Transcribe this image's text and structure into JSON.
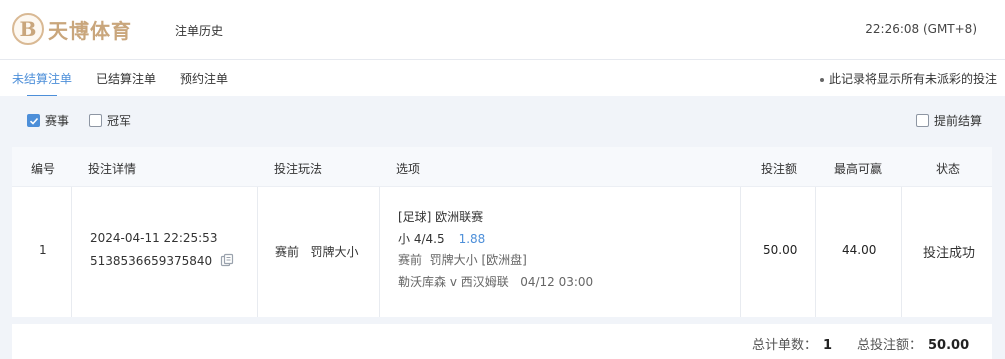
{
  "header": {
    "logo_letter": "B",
    "logo_text": "天博体育",
    "page_title": "注单历史",
    "clock": "22:26:08 (GMT+8)"
  },
  "tabs": [
    {
      "label": "未结算注单",
      "active": true
    },
    {
      "label": "已结算注单",
      "active": false
    },
    {
      "label": "预约注单",
      "active": false
    }
  ],
  "tab_note": "此记录将显示所有未派彩的投注",
  "filters": {
    "event": {
      "label": "赛事",
      "checked": true
    },
    "champion": {
      "label": "冠军",
      "checked": false
    },
    "cashout": {
      "label": "提前结算",
      "checked": false
    }
  },
  "table": {
    "headers": {
      "no": "编号",
      "detail": "投注详情",
      "play": "投注玩法",
      "option": "选项",
      "stake": "投注额",
      "max_win": "最高可赢",
      "status": "状态"
    },
    "rows": [
      {
        "no": "1",
        "datetime": "2024-04-11 22:25:53",
        "ticket_id": "5138536659375840",
        "play": "赛前   罚牌大小",
        "league": "[足球] 欧洲联赛",
        "selection": "小 4/4.5",
        "odds": "1.88",
        "market": "赛前  罚牌大小 [欧洲盘]",
        "match": "勒沃库森 v 西汉姆联",
        "match_time": "04/12 03:00",
        "stake": "50.00",
        "max_win": "44.00",
        "status": "投注成功"
      }
    ]
  },
  "footer": {
    "total_count_label": "总计单数：",
    "total_count": "1",
    "total_stake_label": "总投注额：",
    "total_stake": "50.00"
  },
  "colors": {
    "accent": "#4d8fd9",
    "logo": "#c9a67c",
    "content_bg": "#f1f4f9"
  }
}
